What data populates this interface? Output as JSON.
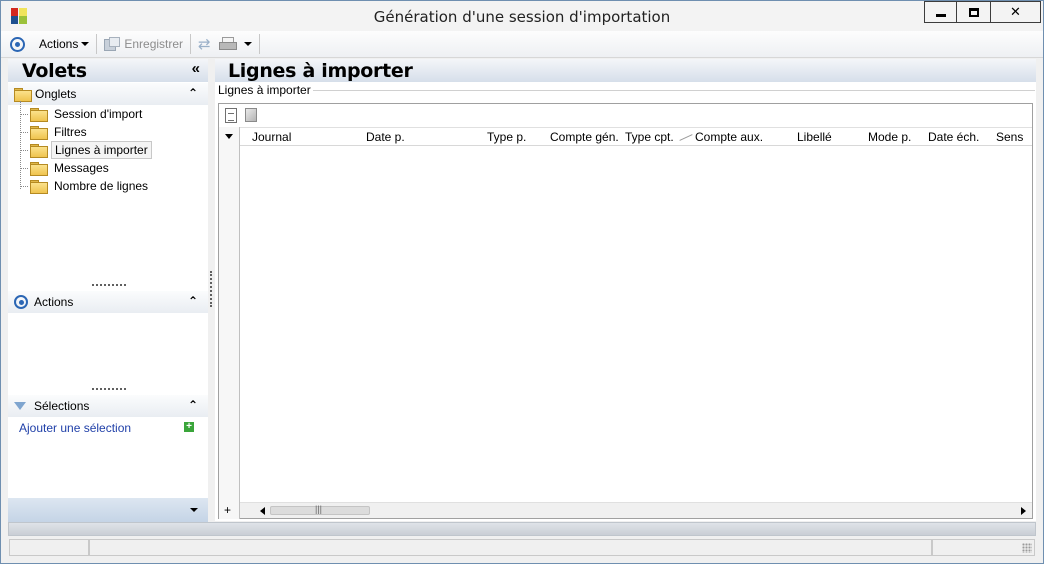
{
  "window": {
    "title": "Génération d'une session d'importation",
    "minimize_label": "▁",
    "maximize_label": "□",
    "close_label": "✕"
  },
  "toolbar": {
    "actions_label": "Actions",
    "save_label": "Enregistrer"
  },
  "left_panel": {
    "title": "Volets",
    "collapse_glyph": "«",
    "tabs_section": {
      "label": "Onglets",
      "items": [
        {
          "label": "Session d'import",
          "selected": false
        },
        {
          "label": "Filtres",
          "selected": false
        },
        {
          "label": "Lignes à importer",
          "selected": true
        },
        {
          "label": "Messages",
          "selected": false
        },
        {
          "label": "Nombre de lignes",
          "selected": false
        }
      ]
    },
    "actions_section": {
      "label": "Actions"
    },
    "selections_section": {
      "label": "Sélections",
      "add_link": "Ajouter une sélection"
    },
    "section_collapse_glyph": "⌃"
  },
  "main": {
    "title": "Lignes à importer",
    "group_label": "Lignes à importer",
    "columns": [
      "Journal",
      "Date p.",
      "Type p.",
      "Compte gén.",
      "Type cpt.",
      "Compte aux.",
      "Libellé",
      "Mode p.",
      "Date éch.",
      "Sens"
    ],
    "add_row_glyph": "+"
  },
  "colors": {
    "accent": "#2b66b4",
    "panel_header": "#d6dfea",
    "link": "#1f3fa8"
  }
}
